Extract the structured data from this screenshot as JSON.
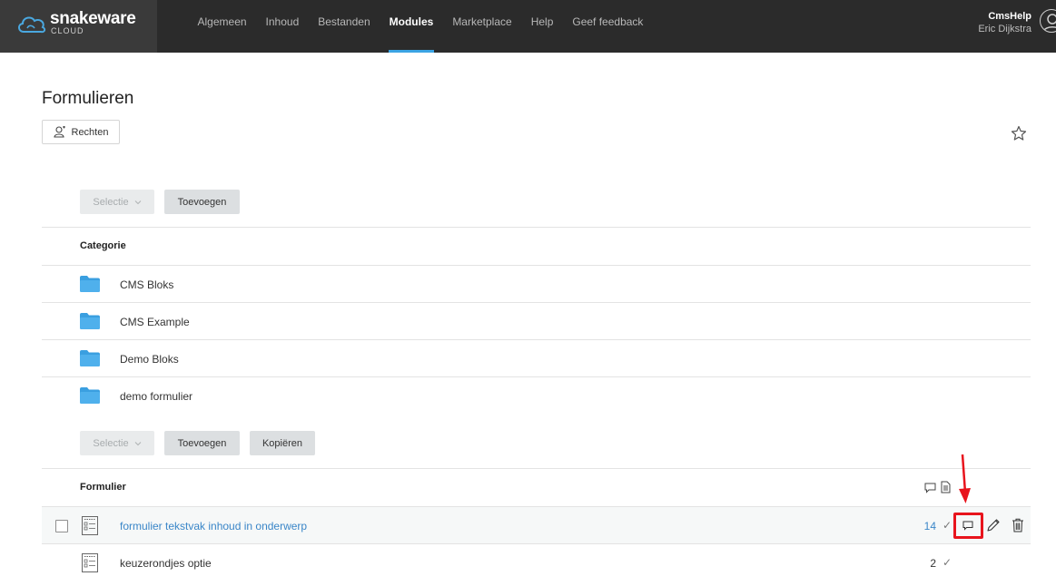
{
  "brand": {
    "name": "snakeware",
    "sub": "CLOUD"
  },
  "nav": {
    "items": [
      {
        "label": "Algemeen",
        "active": false
      },
      {
        "label": "Inhoud",
        "active": false
      },
      {
        "label": "Bestanden",
        "active": false
      },
      {
        "label": "Modules",
        "active": true
      },
      {
        "label": "Marketplace",
        "active": false
      },
      {
        "label": "Help",
        "active": false
      },
      {
        "label": "Geef feedback",
        "active": false
      }
    ]
  },
  "user": {
    "site": "CmsHelp",
    "name": "Eric Dijkstra"
  },
  "page": {
    "title": "Formulieren",
    "rights_label": "Rechten"
  },
  "categories": {
    "toolbar": {
      "selection_label": "Selectie",
      "add_label": "Toevoegen"
    },
    "header": "Categorie",
    "items": [
      "CMS Bloks",
      "CMS Example",
      "Demo Bloks",
      "demo formulier"
    ]
  },
  "forms": {
    "toolbar": {
      "selection_label": "Selectie",
      "add_label": "Toevoegen",
      "copy_label": "Kopiëren"
    },
    "header": "Formulier",
    "rows": [
      {
        "label": "formulier tekstvak inhoud in onderwerp",
        "count": "14",
        "highlighted": true
      },
      {
        "label": "keuzerondjes optie",
        "count": "2",
        "highlighted": false
      }
    ]
  },
  "colors": {
    "accent": "#3aa3e3",
    "link": "#3a86c8",
    "annotation": "#e8141d",
    "topbar": "#2b2b2b"
  }
}
